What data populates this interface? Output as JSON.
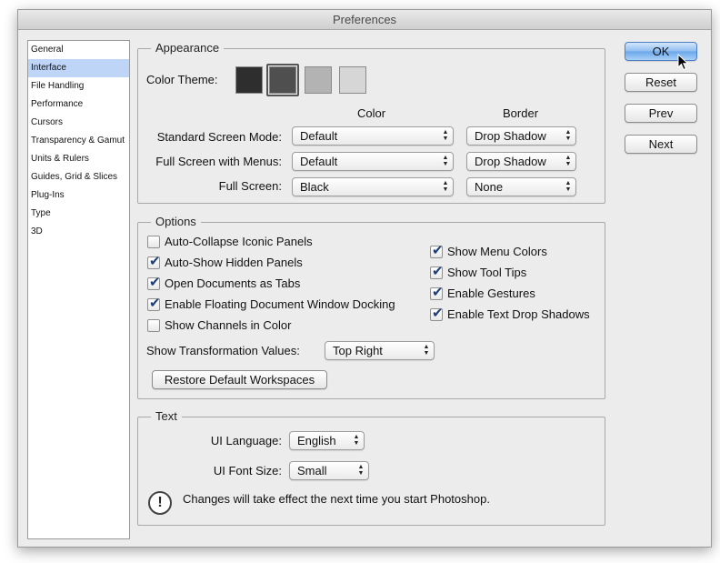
{
  "window": {
    "title": "Preferences"
  },
  "sidebar": {
    "items": [
      {
        "label": "General",
        "selected": false
      },
      {
        "label": "Interface",
        "selected": true
      },
      {
        "label": "File Handling",
        "selected": false
      },
      {
        "label": "Performance",
        "selected": false
      },
      {
        "label": "Cursors",
        "selected": false
      },
      {
        "label": "Transparency & Gamut",
        "selected": false
      },
      {
        "label": "Units & Rulers",
        "selected": false
      },
      {
        "label": "Guides, Grid & Slices",
        "selected": false
      },
      {
        "label": "Plug-Ins",
        "selected": false
      },
      {
        "label": "Type",
        "selected": false
      },
      {
        "label": "3D",
        "selected": false
      }
    ]
  },
  "appearance": {
    "legend": "Appearance",
    "color_theme_label": "Color Theme:",
    "swatches": [
      "#2e2e2e",
      "#4f4f4f",
      "#b3b3b3",
      "#d6d6d6"
    ],
    "selected_swatch_index": 1,
    "col_color": "Color",
    "col_border": "Border",
    "rows": [
      {
        "label": "Standard Screen Mode:",
        "color": "Default",
        "border": "Drop Shadow"
      },
      {
        "label": "Full Screen with Menus:",
        "color": "Default",
        "border": "Drop Shadow"
      },
      {
        "label": "Full Screen:",
        "color": "Black",
        "border": "None"
      }
    ]
  },
  "options": {
    "legend": "Options",
    "left": [
      {
        "label": "Auto-Collapse Iconic Panels",
        "checked": false
      },
      {
        "label": "Auto-Show Hidden Panels",
        "checked": true
      },
      {
        "label": "Open Documents as Tabs",
        "checked": true
      },
      {
        "label": "Enable Floating Document Window Docking",
        "checked": true
      },
      {
        "label": "Show Channels in Color",
        "checked": false
      }
    ],
    "right": [
      {
        "label": "Show Menu Colors",
        "checked": true
      },
      {
        "label": "Show Tool Tips",
        "checked": true
      },
      {
        "label": "Enable Gestures",
        "checked": true
      },
      {
        "label": "Enable Text Drop Shadows",
        "checked": true
      }
    ],
    "transform_label": "Show Transformation Values:",
    "transform_value": "Top Right",
    "restore_label": "Restore Default Workspaces"
  },
  "text": {
    "legend": "Text",
    "language_label": "UI Language:",
    "language_value": "English",
    "font_size_label": "UI Font Size:",
    "font_size_value": "Small",
    "notice": "Changes will take effect the next time you start Photoshop.",
    "alert_glyph": "!"
  },
  "buttons": {
    "ok": "OK",
    "reset": "Reset",
    "prev": "Prev",
    "next": "Next"
  },
  "icons": {
    "select_arrows": "up-down-arrows-icon",
    "check": "✔"
  }
}
